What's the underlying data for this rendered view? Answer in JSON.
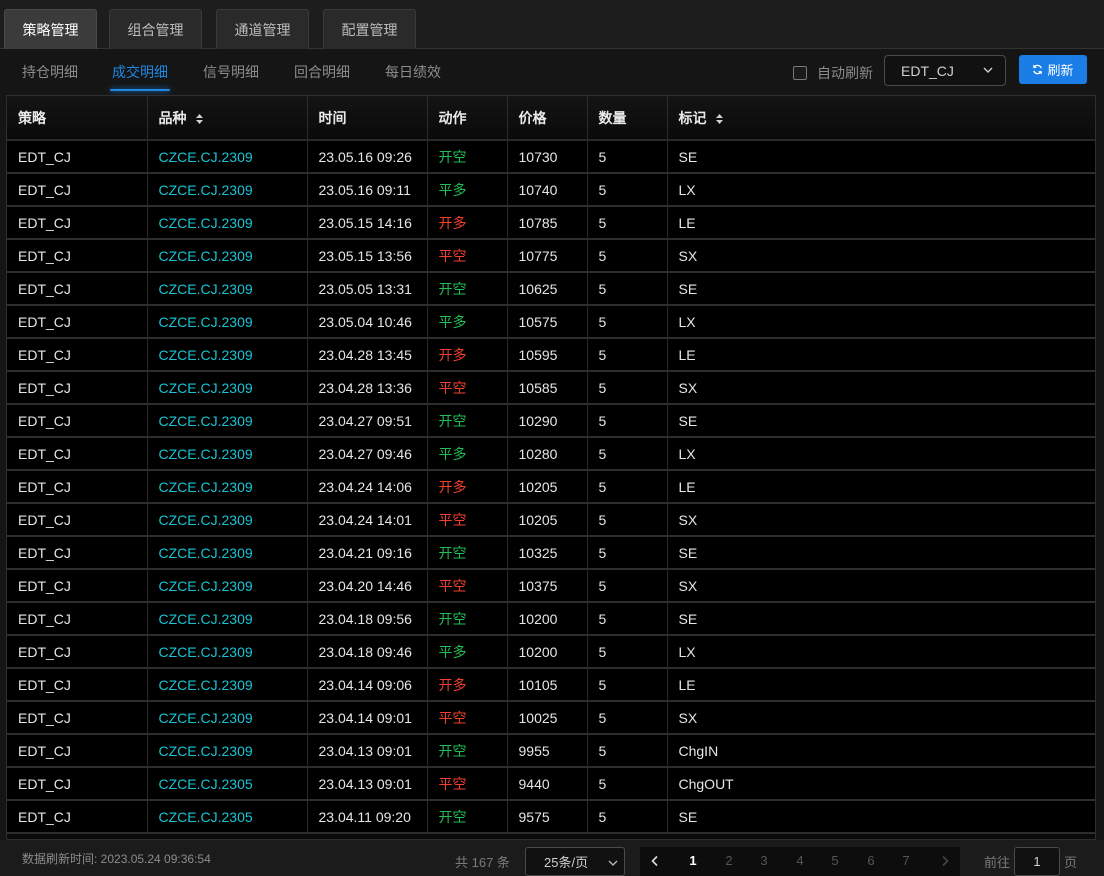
{
  "top_tabs": [
    {
      "label": "策略管理",
      "active": true
    },
    {
      "label": "组合管理",
      "active": false
    },
    {
      "label": "通道管理",
      "active": false
    },
    {
      "label": "配置管理",
      "active": false
    }
  ],
  "sub_tabs": [
    {
      "label": "持仓明细",
      "active": false
    },
    {
      "label": "成交明细",
      "active": true
    },
    {
      "label": "信号明细",
      "active": false
    },
    {
      "label": "回合明细",
      "active": false
    },
    {
      "label": "每日绩效",
      "active": false
    }
  ],
  "toolbar": {
    "auto_refresh_label": "自动刷新",
    "auto_refresh_checked": false,
    "strategy_value": "EDT_CJ",
    "refresh_label": "刷新"
  },
  "table": {
    "columns": [
      {
        "label": "策略",
        "sortable": false
      },
      {
        "label": "品种",
        "sortable": true
      },
      {
        "label": "时间",
        "sortable": false
      },
      {
        "label": "动作",
        "sortable": false
      },
      {
        "label": "价格",
        "sortable": false
      },
      {
        "label": "数量",
        "sortable": false
      },
      {
        "label": "标记",
        "sortable": true
      }
    ],
    "rows": [
      {
        "strategy": "EDT_CJ",
        "symbol": "CZCE.CJ.2309",
        "time": "23.05.16 09:26",
        "action": "开空",
        "action_color": "green",
        "price": "10730",
        "qty": "5",
        "tag": "SE"
      },
      {
        "strategy": "EDT_CJ",
        "symbol": "CZCE.CJ.2309",
        "time": "23.05.16 09:11",
        "action": "平多",
        "action_color": "green",
        "price": "10740",
        "qty": "5",
        "tag": "LX"
      },
      {
        "strategy": "EDT_CJ",
        "symbol": "CZCE.CJ.2309",
        "time": "23.05.15 14:16",
        "action": "开多",
        "action_color": "red",
        "price": "10785",
        "qty": "5",
        "tag": "LE"
      },
      {
        "strategy": "EDT_CJ",
        "symbol": "CZCE.CJ.2309",
        "time": "23.05.15 13:56",
        "action": "平空",
        "action_color": "red",
        "price": "10775",
        "qty": "5",
        "tag": "SX"
      },
      {
        "strategy": "EDT_CJ",
        "symbol": "CZCE.CJ.2309",
        "time": "23.05.05 13:31",
        "action": "开空",
        "action_color": "green",
        "price": "10625",
        "qty": "5",
        "tag": "SE"
      },
      {
        "strategy": "EDT_CJ",
        "symbol": "CZCE.CJ.2309",
        "time": "23.05.04 10:46",
        "action": "平多",
        "action_color": "green",
        "price": "10575",
        "qty": "5",
        "tag": "LX"
      },
      {
        "strategy": "EDT_CJ",
        "symbol": "CZCE.CJ.2309",
        "time": "23.04.28 13:45",
        "action": "开多",
        "action_color": "red",
        "price": "10595",
        "qty": "5",
        "tag": "LE"
      },
      {
        "strategy": "EDT_CJ",
        "symbol": "CZCE.CJ.2309",
        "time": "23.04.28 13:36",
        "action": "平空",
        "action_color": "red",
        "price": "10585",
        "qty": "5",
        "tag": "SX"
      },
      {
        "strategy": "EDT_CJ",
        "symbol": "CZCE.CJ.2309",
        "time": "23.04.27 09:51",
        "action": "开空",
        "action_color": "green",
        "price": "10290",
        "qty": "5",
        "tag": "SE"
      },
      {
        "strategy": "EDT_CJ",
        "symbol": "CZCE.CJ.2309",
        "time": "23.04.27 09:46",
        "action": "平多",
        "action_color": "green",
        "price": "10280",
        "qty": "5",
        "tag": "LX"
      },
      {
        "strategy": "EDT_CJ",
        "symbol": "CZCE.CJ.2309",
        "time": "23.04.24 14:06",
        "action": "开多",
        "action_color": "red",
        "price": "10205",
        "qty": "5",
        "tag": "LE"
      },
      {
        "strategy": "EDT_CJ",
        "symbol": "CZCE.CJ.2309",
        "time": "23.04.24 14:01",
        "action": "平空",
        "action_color": "red",
        "price": "10205",
        "qty": "5",
        "tag": "SX"
      },
      {
        "strategy": "EDT_CJ",
        "symbol": "CZCE.CJ.2309",
        "time": "23.04.21 09:16",
        "action": "开空",
        "action_color": "green",
        "price": "10325",
        "qty": "5",
        "tag": "SE"
      },
      {
        "strategy": "EDT_CJ",
        "symbol": "CZCE.CJ.2309",
        "time": "23.04.20 14:46",
        "action": "平空",
        "action_color": "red",
        "price": "10375",
        "qty": "5",
        "tag": "SX"
      },
      {
        "strategy": "EDT_CJ",
        "symbol": "CZCE.CJ.2309",
        "time": "23.04.18 09:56",
        "action": "开空",
        "action_color": "green",
        "price": "10200",
        "qty": "5",
        "tag": "SE"
      },
      {
        "strategy": "EDT_CJ",
        "symbol": "CZCE.CJ.2309",
        "time": "23.04.18 09:46",
        "action": "平多",
        "action_color": "green",
        "price": "10200",
        "qty": "5",
        "tag": "LX"
      },
      {
        "strategy": "EDT_CJ",
        "symbol": "CZCE.CJ.2309",
        "time": "23.04.14 09:06",
        "action": "开多",
        "action_color": "red",
        "price": "10105",
        "qty": "5",
        "tag": "LE"
      },
      {
        "strategy": "EDT_CJ",
        "symbol": "CZCE.CJ.2309",
        "time": "23.04.14 09:01",
        "action": "平空",
        "action_color": "red",
        "price": "10025",
        "qty": "5",
        "tag": "SX"
      },
      {
        "strategy": "EDT_CJ",
        "symbol": "CZCE.CJ.2309",
        "time": "23.04.13 09:01",
        "action": "开空",
        "action_color": "green",
        "price": "9955",
        "qty": "5",
        "tag": "ChgIN"
      },
      {
        "strategy": "EDT_CJ",
        "symbol": "CZCE.CJ.2305",
        "time": "23.04.13 09:01",
        "action": "平空",
        "action_color": "red",
        "price": "9440",
        "qty": "5",
        "tag": "ChgOUT"
      },
      {
        "strategy": "EDT_CJ",
        "symbol": "CZCE.CJ.2305",
        "time": "23.04.11 09:20",
        "action": "开空",
        "action_color": "green",
        "price": "9575",
        "qty": "5",
        "tag": "SE"
      }
    ]
  },
  "footer": {
    "update_time": "数据刷新时间: 2023.05.24 09:36:54",
    "total": "共 167 条",
    "page_size": "25条/页",
    "pages": [
      "1",
      "2",
      "3",
      "4",
      "5",
      "6",
      "7"
    ],
    "current_page": "1",
    "goto_label": "前往",
    "goto_value": "1",
    "page_suffix": "页"
  },
  "colors": {
    "accent": "#1e88e5",
    "symbol": "#18c4d4",
    "action_green": "#22bd55",
    "action_red": "#f1402f"
  }
}
